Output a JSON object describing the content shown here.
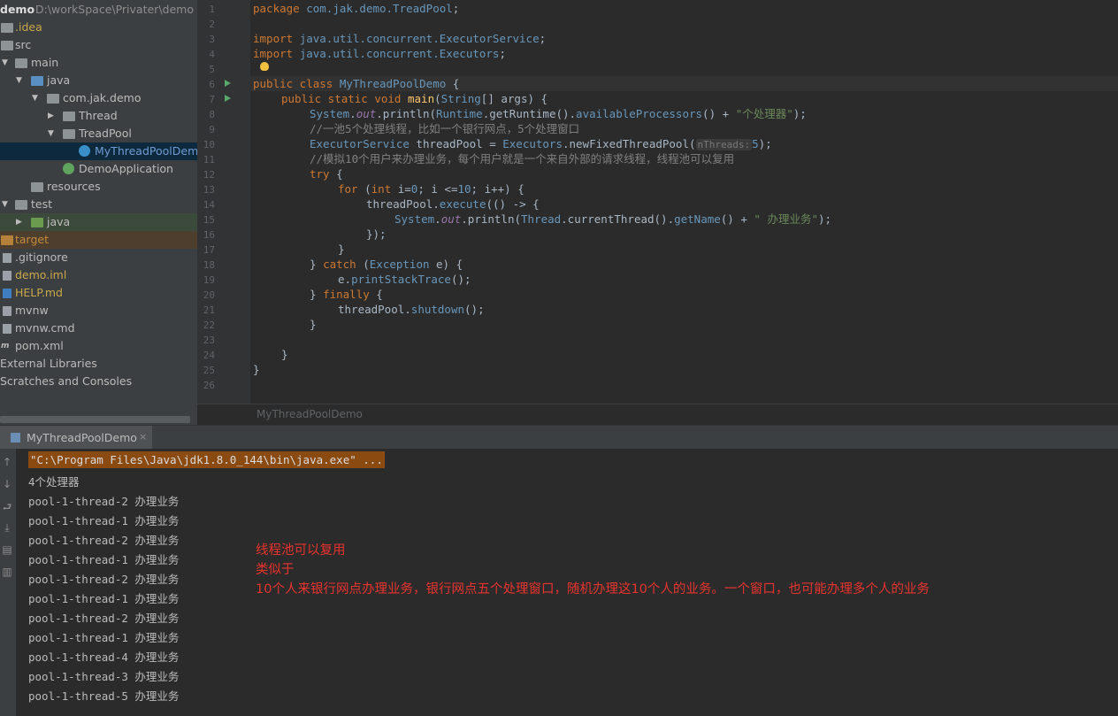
{
  "project": {
    "name": "demo",
    "path": "D:\\workSpace\\Privater\\demo",
    "tree": [
      {
        "label": ".idea",
        "icon": "folder-icon"
      },
      {
        "label": "src",
        "icon": "folder-icon"
      },
      {
        "label": "main",
        "icon": "folder-icon"
      },
      {
        "label": "java",
        "icon": "source-folder-icon"
      },
      {
        "label": "com.jak.demo",
        "icon": "package-icon"
      },
      {
        "label": "Thread",
        "icon": "package-icon"
      },
      {
        "label": "TreadPool",
        "icon": "package-icon"
      },
      {
        "label": "MyThreadPoolDemo",
        "icon": "java-class-icon"
      },
      {
        "label": "DemoApplication",
        "icon": "spring-class-icon"
      },
      {
        "label": "resources",
        "icon": "resources-folder-icon"
      },
      {
        "label": "test",
        "icon": "folder-icon"
      },
      {
        "label": "java",
        "icon": "test-folder-icon"
      },
      {
        "label": "target",
        "icon": "excluded-folder-icon"
      },
      {
        "label": ".gitignore",
        "icon": "file-icon"
      },
      {
        "label": "demo.iml",
        "icon": "module-file-icon"
      },
      {
        "label": "HELP.md",
        "icon": "markdown-file-icon"
      },
      {
        "label": "mvnw",
        "icon": "script-file-icon"
      },
      {
        "label": "mvnw.cmd",
        "icon": "script-file-icon"
      },
      {
        "label": "pom.xml",
        "icon": "maven-icon"
      },
      {
        "label": "External Libraries",
        "icon": "library-icon"
      },
      {
        "label": "Scratches and Consoles",
        "icon": "scratch-icon"
      }
    ]
  },
  "editor": {
    "line_numbers": [
      "1",
      "2",
      "3",
      "4",
      "5",
      "6",
      "7",
      "8",
      "9",
      "10",
      "11",
      "12",
      "13",
      "14",
      "15",
      "16",
      "17",
      "18",
      "19",
      "20",
      "21",
      "22",
      "23",
      "24",
      "25",
      "26"
    ],
    "param_hint": "nThreads:",
    "breadcrumb": "MyThreadPoolDemo",
    "code": {
      "l1_kw": "package",
      "l1_pkg": "com.jak.demo.TreadPool",
      "l1_end": ";",
      "l3_kw": "import",
      "l3_pkg": "java.util.concurrent.ExecutorService",
      "l3_end": ";",
      "l4_kw": "import",
      "l4_pkg": "java.util.concurrent.Executors",
      "l4_end": ";",
      "l6_kw": "public class",
      "l6_cls": "MyThreadPoolDemo",
      "l6_end": " {",
      "l7_kw": "public static void",
      "l7_fn": "main",
      "l7_a": "(",
      "l7_type": "String",
      "l7_b": "[] args) {",
      "l8_a": "System",
      "l8_b": ".",
      "l8_fld": "out",
      "l8_c": ".println(",
      "l8_d": "Runtime",
      "l8_e": ".getRuntime().",
      "l8_f": "availableProcessors",
      "l8_g": "() + ",
      "l8_str": "\"个处理器\"",
      "l8_end": ");",
      "l9_cmt": "//一池5个处理线程，比如一个银行网点，5个处理窗口",
      "l10_a": "ExecutorService",
      "l10_b": " threadPool = ",
      "l10_c": "Executors",
      "l10_d": ".newFixedThreadPool(",
      "l10_num": "5",
      "l10_end": ");",
      "l11_cmt": "//模拟10个用户来办理业务，每个用户就是一个来自外部的请求线程，线程池可以复用",
      "l12_kw": "try",
      "l12_end": " {",
      "l13_kw": "for",
      "l13_a": " (",
      "l13_kw2": "int",
      "l13_b": " i=",
      "l13_n0": "0",
      "l13_c": "; i <=",
      "l13_n10": "10",
      "l13_d": "; i++) {",
      "l14_a": "threadPool.",
      "l14_m": "execute",
      "l14_b": "(() -> {",
      "l15_a": "System",
      "l15_b": ".",
      "l15_fld": "out",
      "l15_c": ".println(",
      "l15_d": "Thread",
      "l15_e": ".currentThread().",
      "l15_f": "getName",
      "l15_g": "() + ",
      "l15_str": "\" 办理业务\"",
      "l15_end": ");",
      "l16": "});",
      "l17": "}",
      "l18_a": "} ",
      "l18_kw": "catch",
      "l18_b": " (",
      "l18_cls": "Exception",
      "l18_c": " e) {",
      "l19_a": "e.",
      "l19_m": "printStackTrace",
      "l19_b": "();",
      "l20_a": "} ",
      "l20_kw": "finally",
      "l20_b": " {",
      "l21_a": "threadPool.",
      "l21_m": "shutdown",
      "l21_b": "();",
      "l22": "}",
      "l24": "}",
      "l25": "}"
    }
  },
  "run": {
    "tab": "MyThreadPoolDemo",
    "tab_close": "×",
    "command": "\"C:\\Program Files\\Java\\jdk1.8.0_144\\bin\\java.exe\" ...",
    "output": [
      "4个处理器",
      "pool-1-thread-2 办理业务",
      "pool-1-thread-1 办理业务",
      "pool-1-thread-2 办理业务",
      "pool-1-thread-1 办理业务",
      "pool-1-thread-2 办理业务",
      "pool-1-thread-1 办理业务",
      "pool-1-thread-2 办理业务",
      "pool-1-thread-1 办理业务",
      "pool-1-thread-4 办理业务",
      "pool-1-thread-3 办理业务",
      "pool-1-thread-5 办理业务"
    ],
    "side_icons": [
      "up-arrow-icon",
      "down-arrow-icon",
      "soft-wrap-icon",
      "scroll-to-end-icon",
      "print-icon",
      "trash-icon"
    ]
  },
  "annotation": {
    "line1": "线程池可以复用",
    "line2": "类似于",
    "line3": "10个人来银行网点办理业务，银行网点五个处理窗口，随机办理这10个人的业务。一个窗口，也可能办理多个人的业务"
  },
  "colors": {
    "accent_red": "#e8332e",
    "keyword": "#cc7832",
    "string": "#6a8759",
    "run_cmd_bg": "#8a4a10"
  }
}
